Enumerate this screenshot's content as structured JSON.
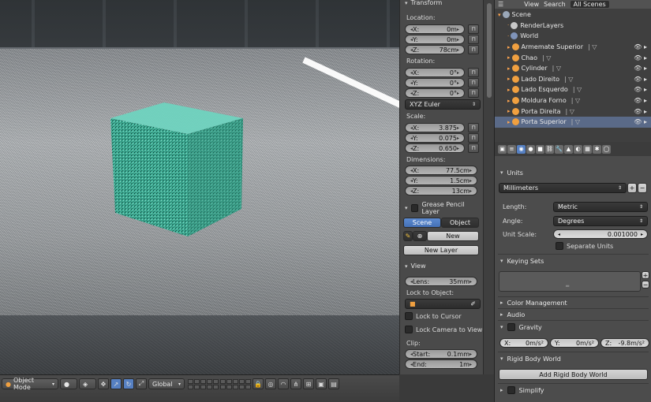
{
  "npanel": {
    "transform_title": "Transform",
    "location_label": "Location:",
    "location": [
      {
        "k": "X:",
        "v": "0m"
      },
      {
        "k": "Y:",
        "v": "0m"
      },
      {
        "k": "Z:",
        "v": "78cm"
      }
    ],
    "rotation_label": "Rotation:",
    "rotation": [
      {
        "k": "X:",
        "v": "0°"
      },
      {
        "k": "Y:",
        "v": "0°"
      },
      {
        "k": "Z:",
        "v": "0°"
      }
    ],
    "rotation_mode": "XYZ Euler",
    "scale_label": "Scale:",
    "scale": [
      {
        "k": "X:",
        "v": "3.875"
      },
      {
        "k": "Y:",
        "v": "0.075"
      },
      {
        "k": "Z:",
        "v": "0.650"
      }
    ],
    "dimensions_label": "Dimensions:",
    "dimensions": [
      {
        "k": "X:",
        "v": "77.5cm"
      },
      {
        "k": "Y:",
        "v": "1.5cm"
      },
      {
        "k": "Z:",
        "v": "13cm"
      }
    ],
    "grease_pencil_title": "Grease Pencil Layer",
    "gp_scene": "Scene",
    "gp_object": "Object",
    "gp_new": "New",
    "gp_new_layer": "New Layer",
    "view_title": "View",
    "lens_label": "Lens:",
    "lens_value": "35mm",
    "lock_to_object_label": "Lock to Object:",
    "lock_to_cursor": "Lock to Cursor",
    "lock_camera_to_view": "Lock Camera to View",
    "clip_label": "Clip:",
    "clip_start_label": "Start:",
    "clip_start": "0.1mm",
    "clip_end_label": "End:",
    "clip_end": "1m"
  },
  "viewport_header": {
    "mode": "Object Mode",
    "orientation": "Global"
  },
  "outliner": {
    "menu_view": "View",
    "menu_search": "Search",
    "display_mode": "All Scenes",
    "rows": [
      {
        "label": "Scene"
      },
      {
        "label": "RenderLayers"
      },
      {
        "label": "World"
      },
      {
        "label": "Armemate Superior"
      },
      {
        "label": "Chao"
      },
      {
        "label": "Cylinder"
      },
      {
        "label": "Lado Direito"
      },
      {
        "label": "Lado Esquerdo"
      },
      {
        "label": "Moldura Forno"
      },
      {
        "label": "Porta Direita"
      },
      {
        "label": "Porta Superior"
      }
    ]
  },
  "properties": {
    "units_title": "Units",
    "units_preset": "Millimeters",
    "length_label": "Length:",
    "length_value": "Metric",
    "angle_label": "Angle:",
    "angle_value": "Degrees",
    "unit_scale_label": "Unit Scale:",
    "unit_scale_value": "0.001000",
    "separate_units": "Separate Units",
    "keying_sets_title": "Keying Sets",
    "color_management_title": "Color Management",
    "audio_title": "Audio",
    "gravity_title": "Gravity",
    "gravity": [
      {
        "k": "X:",
        "v": "0m/s²"
      },
      {
        "k": "Y:",
        "v": "0m/s²"
      },
      {
        "k": "Z:",
        "v": "-9.8m/s²"
      }
    ],
    "rigid_body_world_title": "Rigid Body World",
    "add_rigid_body_world": "Add Rigid Body World",
    "simplify_title": "Simplify"
  },
  "colors": {
    "selection_blue": "#5680c2",
    "cube_teal": "#3fae96"
  }
}
